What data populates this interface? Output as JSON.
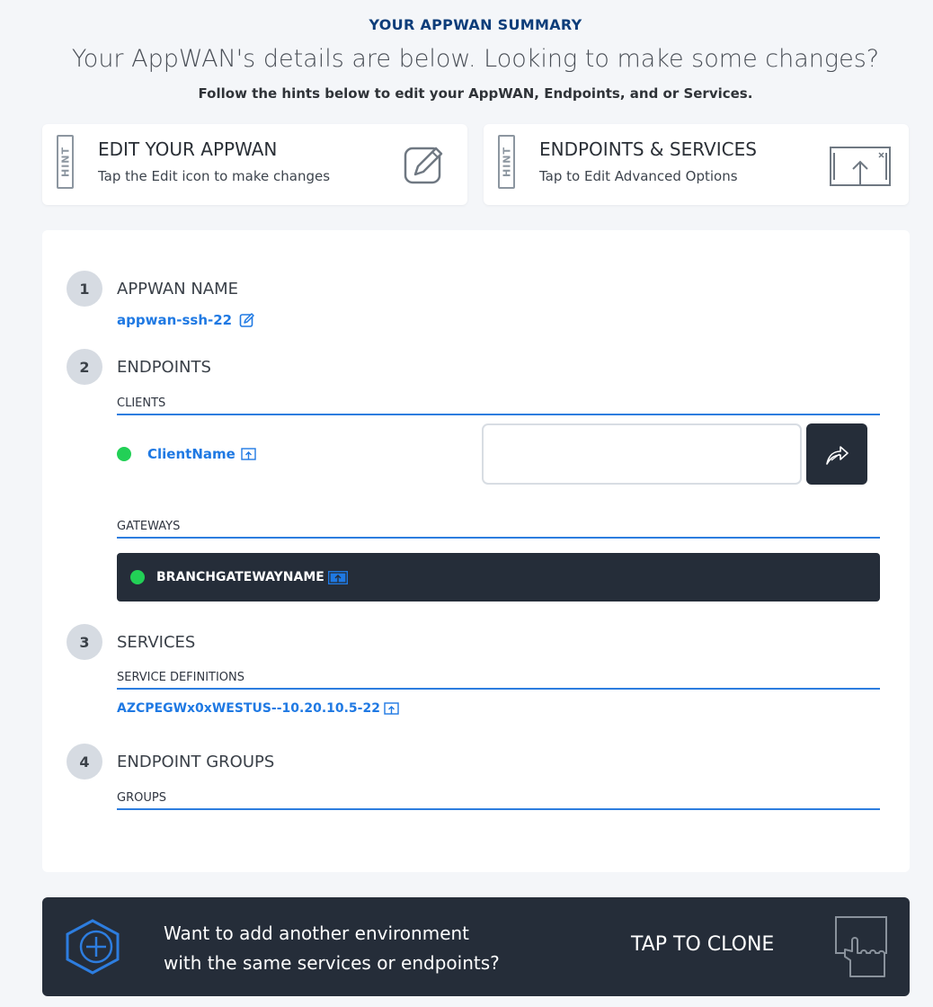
{
  "header": {
    "kicker": "YOUR APPWAN SUMMARY",
    "headline": "Your AppWAN's details are below. Looking to make some changes?",
    "subline": "Follow the hints below to edit your AppWAN, Endpoints, and or Services."
  },
  "hints": [
    {
      "badge": "HINT",
      "title": "EDIT YOUR APPWAN",
      "subtitle": "Tap the Edit icon to make changes",
      "icon": "edit-pencil-icon"
    },
    {
      "badge": "HINT",
      "title": "ENDPOINTS & SERVICES",
      "subtitle": "Tap to Edit Advanced Options",
      "icon": "open-window-icon"
    }
  ],
  "steps": {
    "appwan_name": {
      "number": "1",
      "title": "APPWAN NAME",
      "value": "appwan-ssh-22",
      "icon": "edit-pencil-icon"
    },
    "endpoints": {
      "number": "2",
      "title": "ENDPOINTS",
      "clients_label": "CLIENTS",
      "client": {
        "name": "ClientName",
        "status": "online",
        "icon": "open-window-icon"
      },
      "client_input": {
        "value": "",
        "placeholder": ""
      },
      "send_icon": "share-arrow-icon",
      "gateways_label": "GATEWAYS",
      "gateway": {
        "name": "BRANCHGATEWAYNAME",
        "status": "online",
        "icon": "open-window-icon"
      }
    },
    "services": {
      "number": "3",
      "title": "SERVICES",
      "definitions_label": "SERVICE DEFINITIONS",
      "service": "AZCPEGWx0xWESTUS--10.20.10.5-22",
      "icon": "open-window-icon"
    },
    "endpoint_groups": {
      "number": "4",
      "title": "ENDPOINT GROUPS",
      "groups_label": "GROUPS"
    }
  },
  "clone": {
    "text_line1": "Want to add another environment",
    "text_line2": "with the same services or endpoints?",
    "cta": "TAP TO CLONE",
    "left_icon": "hexagon-plus-icon",
    "right_icon": "tap-hand-icon"
  },
  "colors": {
    "accent_blue": "#1f79e3",
    "navy": "#0d3d7a",
    "dark": "#252d39",
    "status_green": "#22d056",
    "background": "#f4f6f9"
  }
}
